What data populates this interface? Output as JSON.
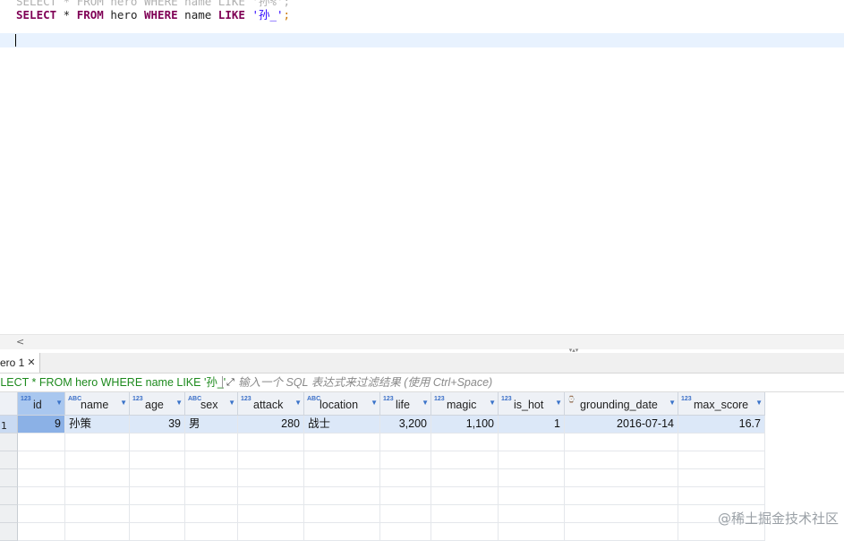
{
  "editor": {
    "prev_line": "SELECT * FROM hero WHERE name LIKE '孙%';",
    "query_keyword_select": "SELECT",
    "query_star": " * ",
    "query_keyword_from": "FROM",
    "query_table": " hero ",
    "query_keyword_where": "WHERE",
    "query_column": " name ",
    "query_keyword_like": "LIKE",
    "query_space": " ",
    "query_string": "'孙_'",
    "query_semicolon": ";"
  },
  "result_tab": {
    "label": "ero 1",
    "close_icon": "✕"
  },
  "filter": {
    "query_text": "ELECT * FROM hero WHERE name LIKE '孙_'",
    "expand_icon": "⤢",
    "placeholder": "输入一个 SQL 表达式来过滤结果 (使用 Ctrl+Space)"
  },
  "table": {
    "columns": [
      {
        "name": "id",
        "type_icon": "123"
      },
      {
        "name": "name",
        "type_icon": "ABC"
      },
      {
        "name": "age",
        "type_icon": "123"
      },
      {
        "name": "sex",
        "type_icon": "ABC"
      },
      {
        "name": "attack",
        "type_icon": "123"
      },
      {
        "name": "location",
        "type_icon": "ABC"
      },
      {
        "name": "life",
        "type_icon": "123"
      },
      {
        "name": "magic",
        "type_icon": "123"
      },
      {
        "name": "is_hot",
        "type_icon": "123"
      },
      {
        "name": "grounding_date",
        "type_icon": "⌚"
      },
      {
        "name": "max_score",
        "type_icon": "123"
      }
    ],
    "rows": [
      {
        "row_number": "1",
        "cells": [
          "9",
          "孙策",
          "39",
          "男",
          "280",
          "战士",
          "3,200",
          "1,100",
          "1",
          "2016-07-14",
          "16.7"
        ]
      }
    ]
  },
  "watermark": "@稀土掘金技术社区"
}
